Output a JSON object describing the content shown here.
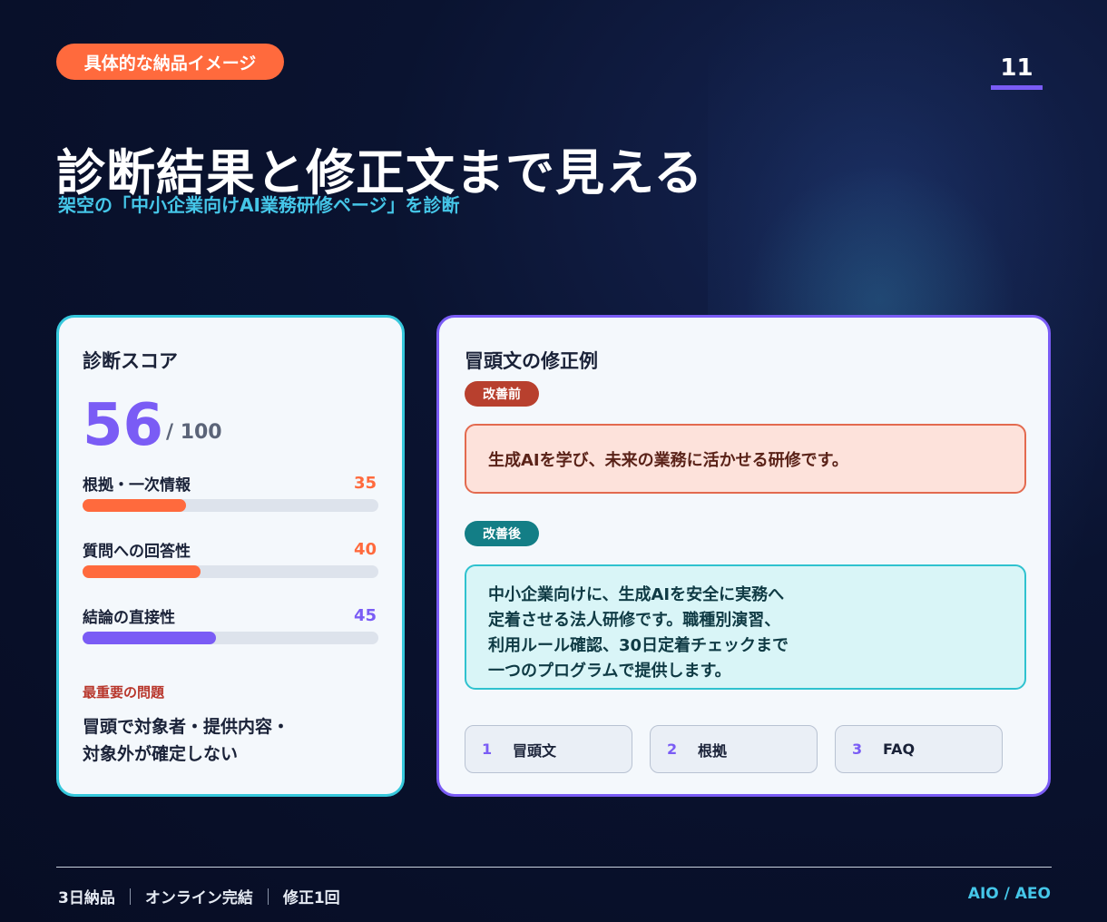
{
  "header": {
    "tag": "具体的な納品イメージ",
    "page_number": "11",
    "title": "診断結果と修正文まで見える",
    "subtitle": "架空の「中小企業向けAI業務研修ページ」を診断"
  },
  "score_card": {
    "heading": "診断スコア",
    "score": "56",
    "score_max": "/ 100",
    "metrics": [
      {
        "label": "根拠・一次情報",
        "value": "35",
        "fraction": 0.35,
        "color": "#ff6a3d"
      },
      {
        "label": "質問への回答性",
        "value": "40",
        "fraction": 0.4,
        "color": "#ff6a3d"
      },
      {
        "label": "結論の直接性",
        "value": "45",
        "fraction": 0.45,
        "color": "#7a5cf5"
      }
    ],
    "problem_label": "最重要の問題",
    "problem_lines": [
      "冒頭で対象者・提供内容・",
      "対象外が確定しない"
    ]
  },
  "revision_card": {
    "heading": "冒頭文の修正例",
    "before_badge": "改善前",
    "before_text": "生成AIを学び、未来の業務に活かせる研修です。",
    "after_badge": "改善後",
    "after_lines": [
      "中小企業向けに、生成AIを安全に実務へ",
      "定着させる法人研修です。職種別演習、",
      "利用ルール確認、30日定着チェックまで",
      "一つのプログラムで提供します。"
    ],
    "steps": [
      {
        "num": "1",
        "label": "冒頭文"
      },
      {
        "num": "2",
        "label": "根拠"
      },
      {
        "num": "3",
        "label": "FAQ"
      }
    ]
  },
  "footer": {
    "items": [
      "3日納品",
      "オンライン完結",
      "修正1回"
    ],
    "right": "AIO / AEO"
  },
  "colors": {
    "accent_orange": "#ff6a3d",
    "accent_purple": "#7a5cf5",
    "accent_cyan": "#45c6e8"
  }
}
